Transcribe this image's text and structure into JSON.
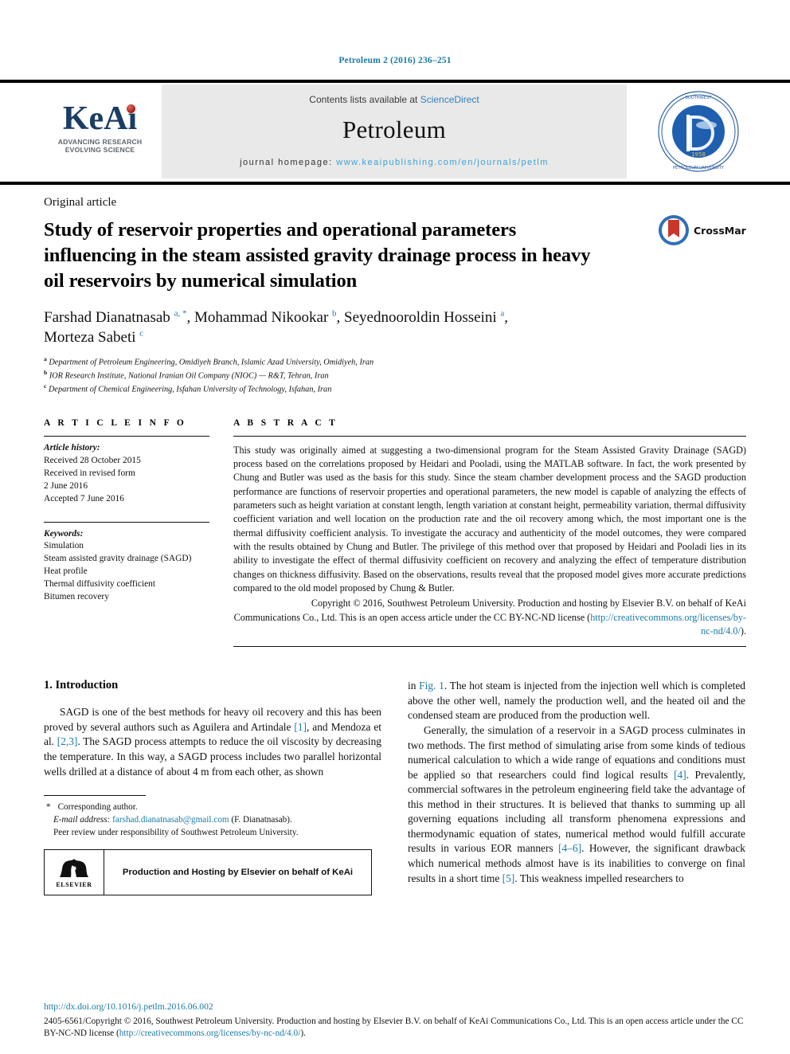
{
  "running_head": "Petroleum 2 (2016) 236–251",
  "header": {
    "keai_word": "KeAi",
    "keai_tagline_line1": "ADVANCING RESEARCH",
    "keai_tagline_line2": "EVOLVING SCIENCE",
    "contents_prefix": "Contents lists available at ",
    "contents_link": "ScienceDirect",
    "journal_title": "Petroleum",
    "homepage_label": "journal homepage: ",
    "homepage_url": "www.keaipublishing.com/en/journals/petlm",
    "seal_name": "southwest-petroleum-university-seal"
  },
  "article": {
    "kind": "Original article",
    "title": "Study of reservoir properties and operational parameters influencing in the steam assisted gravity drainage process in heavy oil reservoirs by numerical simulation",
    "crossmark_label": "CrossMark",
    "authors_line1_a": "Farshad Dianatnasab ",
    "authors_sup1": "a, *",
    "authors_line1_b": ", Mohammad Nikookar ",
    "authors_sup2": "b",
    "authors_line1_c": ", Seyednooroldin Hosseini ",
    "authors_sup3": "a",
    "authors_line1_d": ",",
    "authors_line2": "Morteza Sabeti ",
    "authors_sup4": "c",
    "affiliations": [
      {
        "mark": "a",
        "text": "Department of Petroleum Engineering, Omidiyeh Branch, Islamic Azad University, Omidiyeh, Iran"
      },
      {
        "mark": "b",
        "text": "IOR Research Institute, National Iranian Oil Company (NIOC) — R&T, Tehran, Iran"
      },
      {
        "mark": "c",
        "text": "Department of Chemical Engineering, Isfahan University of Technology, Isfahan, Iran"
      }
    ]
  },
  "info": {
    "heading": "A R T I C L E  I N F O",
    "history_label": "Article history:",
    "history": [
      "Received 28 October 2015",
      "Received in revised form",
      "2 June 2016",
      "Accepted 7 June 2016"
    ],
    "keywords_label": "Keywords:",
    "keywords": [
      "Simulation",
      "Steam assisted gravity drainage (SAGD)",
      "Heat profile",
      "Thermal diffusivity coefficient",
      "Bitumen recovery"
    ]
  },
  "abstract": {
    "heading": "A B S T R A C T",
    "text": "This study was originally aimed at suggesting a two-dimensional program for the Steam Assisted Gravity Drainage (SAGD) process based on the correlations proposed by Heidari and Pooladi, using the MATLAB software. In fact, the work presented by Chung and Butler was used as the basis for this study. Since the steam chamber development process and the SAGD production performance are functions of reservoir properties and operational parameters, the new model is capable of analyzing the effects of parameters such as height variation at constant length, length variation at constant height, permeability variation, thermal diffusivity coefficient variation and well location on the production rate and the oil recovery among which, the most important one is the thermal diffusivity coefficient analysis. To investigate the accuracy and authenticity of the model outcomes, they were compared with the results obtained by Chung and Butler. The privilege of this method over that proposed by Heidari and Pooladi lies in its ability to investigate the effect of thermal diffusivity coefficient on recovery and analyzing the effect of temperature distribution changes on thickness diffusivity. Based on the observations, results reveal that the proposed model gives more accurate predictions compared to the old model proposed by Chung & Butler.",
    "copyright_part1": "Copyright © 2016, Southwest Petroleum University. Production and hosting by Elsevier B.V. on behalf of KeAi Communications Co., Ltd. This is an open access article under the CC BY-NC-ND license (",
    "copyright_link": "http://creativecommons.org/licenses/by-nc-nd/4.0/",
    "copyright_part2": ")."
  },
  "introduction": {
    "heading": "1. Introduction",
    "left_p1_a": "SAGD is one of the best methods for heavy oil recovery and this has been proved by several authors such as Aguilera and Artindale ",
    "left_ref1": "[1]",
    "left_p1_b": ", and Mendoza et al. ",
    "left_ref2": "[2,3]",
    "left_p1_c": ". The SAGD process attempts to reduce the oil viscosity by decreasing the temperature. In this way, a SAGD process includes two parallel horizontal wells drilled at a distance of about 4 m from each other, as shown",
    "right_p1_a": "in ",
    "right_ref_fig": "Fig. 1",
    "right_p1_b": ". The hot steam is injected from the injection well which is completed above the other well, namely the production well, and the heated oil and the condensed steam are produced from the production well.",
    "right_p2_a": "Generally, the simulation of a reservoir in a SAGD process culminates in two methods. The first method of simulating arise from some kinds of tedious numerical calculation to which a wide range of equations and conditions must be applied so that researchers could find logical results ",
    "right_ref4": "[4]",
    "right_p2_b": ". Prevalently, commercial softwares in the petroleum engineering field take the advantage of this method in their structures. It is believed that thanks to summing up all governing equations including all transform phenomena expressions and thermodynamic equation of states, numerical method would fulfill accurate results in various EOR manners ",
    "right_ref46": "[4–6]",
    "right_p2_c": ". However, the significant drawback which numerical methods almost have is its inabilities to converge on final results in a short time ",
    "right_ref5": "[5]",
    "right_p2_d": ". This weakness impelled researchers to"
  },
  "footnote": {
    "star": "*",
    "corresponding": "Corresponding author.",
    "email_label": "E-mail address:",
    "email": "farshad.dianatnasab@gmail.com",
    "email_suffix": "(F. Dianatnasab).",
    "peer_review": "Peer review under responsibility of Southwest Petroleum University."
  },
  "elsevier_box": {
    "logo_word": "ELSEVIER",
    "text": "Production and Hosting by Elsevier on behalf of KeAi"
  },
  "footer": {
    "doi": "http://dx.doi.org/10.1016/j.petlm.2016.06.002",
    "line_a": "2405-6561/Copyright © 2016, Southwest Petroleum University. Production and hosting by Elsevier B.V. on behalf of KeAi Communications Co., Ltd. This is an open access article under the CC BY-NC-ND license (",
    "line_link": "http://creativecommons.org/licenses/by-nc-nd/4.0/",
    "line_b": ")."
  },
  "colors": {
    "link_blue": "#1a7aa8",
    "sciencedirect_blue": "#2f7fbf",
    "homepage_blue": "#3ba3d6",
    "keai_navy": "#1b3c63",
    "keai_red": "#a81c13",
    "band_gray": "#e9e9e9"
  }
}
